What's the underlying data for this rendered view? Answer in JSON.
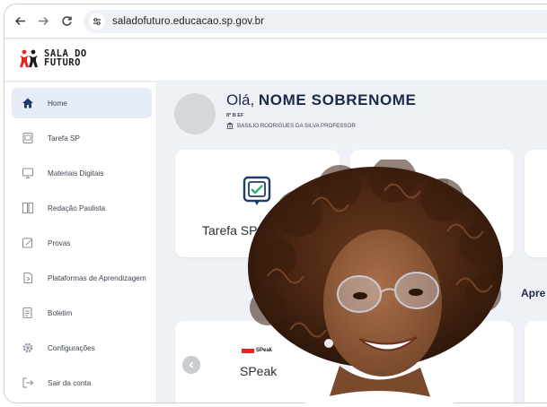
{
  "browser": {
    "url": "saladofuturo.educacao.sp.gov.br",
    "back_icon": "arrow-left-icon",
    "forward_icon": "arrow-right-icon",
    "reload_icon": "reload-icon",
    "site_info_icon": "tune-icon"
  },
  "app": {
    "logo_line1": "SALA DO",
    "logo_line2": "FUTURO",
    "brand_color": "#e5261f"
  },
  "sidebar": {
    "items": [
      {
        "label": "Home",
        "icon": "home-icon",
        "active": true
      },
      {
        "label": "Tarefa SP",
        "icon": "task-icon"
      },
      {
        "label": "Materiais Digitais",
        "icon": "digital-materials-icon"
      },
      {
        "label": "Redação Paulista",
        "icon": "writing-icon"
      },
      {
        "label": "Provas",
        "icon": "exam-icon"
      },
      {
        "label": "Plataformas de Aprendizagem",
        "icon": "platform-icon"
      },
      {
        "label": "Boletim",
        "icon": "report-icon"
      },
      {
        "label": "Configurações",
        "icon": "gear-icon"
      },
      {
        "label": "Sair da conta",
        "icon": "logout-icon"
      }
    ]
  },
  "profile": {
    "greeting": "Olá,",
    "name": "NOME SOBRENOME",
    "grade": "8º B EF",
    "school": "BASILIO RODRIGUES DA SILVA PROFESSOR"
  },
  "cards": {
    "tarefa_label": "Tarefa SP",
    "section_title": "Apre",
    "speak_label": "SPeak",
    "speak_logo": "SPeak"
  },
  "photo": {
    "description_icon": "student-photo-icon"
  }
}
